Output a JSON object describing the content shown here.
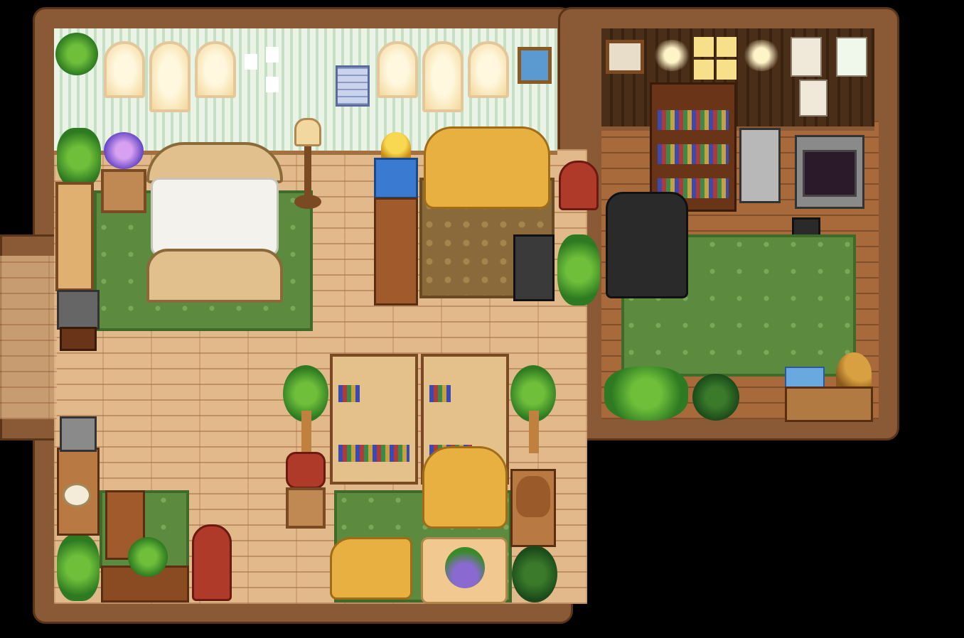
{
  "scene": {
    "location": "farmhouse-interior",
    "rooms": [
      "bedroom",
      "living-room",
      "study"
    ],
    "colors": {
      "background": "#000000",
      "wall_trim": "#8a5a36",
      "floor": "#e2b98a",
      "rug_green": "#5c8a3e",
      "wall_stripes": "#e9f4e6"
    },
    "icons": [
      "bed-icon",
      "window-icon",
      "calendar-icon",
      "trophy-icon",
      "couch-icon",
      "lamp-icon",
      "sewing-machine-icon",
      "armchair-icon",
      "bookshelf-icon",
      "crt-tv-icon",
      "radio-icon",
      "telephone-icon",
      "teddy-bear-icon",
      "potted-plant-icon",
      "painting-icon",
      "fridge-icon"
    ]
  }
}
